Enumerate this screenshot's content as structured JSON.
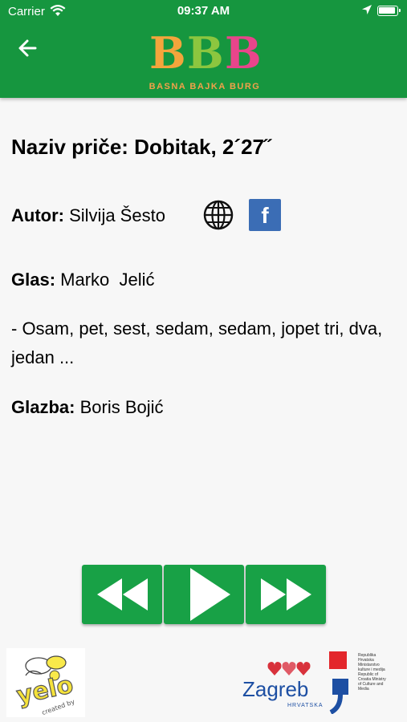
{
  "status": {
    "carrier": "Carrier",
    "time": "09:37 AM"
  },
  "header": {
    "logo_letters": [
      "B",
      "B",
      "B"
    ],
    "logo_subtitle": "BASNA BAJKA BURG",
    "colors": {
      "bar": "#16963f",
      "logo_orange": "#f4a53c",
      "logo_green": "#8cc63f",
      "logo_pink": "#e8458b"
    }
  },
  "story": {
    "title": "Naziv priče: Dobitak, 2´27˝",
    "author_label": "Autor:",
    "author_name": "Silvija Šesto",
    "voice_label": "Glas:",
    "voice_name": "Marko  Jelić",
    "quote": "- Osam, pet, sest, sedam, sedam, jopet tri, dva, jedan ...",
    "music_label": "Glazba:",
    "music_name": "Boris Bojić"
  },
  "icons": {
    "back": "arrow-left-icon",
    "web": "globe-icon",
    "facebook": "facebook-icon",
    "facebook_glyph": "f",
    "rewind": "rewind-icon",
    "play": "play-icon",
    "forward": "fast-forward-icon"
  },
  "controls_color": "#18a146",
  "footer": {
    "left_logo_text": "yelo",
    "left_logo_caption": "created by",
    "zagreb_text": "Zagreb",
    "zagreb_sub": "HRVATSKA",
    "ministry_text": "Republika Hrvatska Ministarstvo kulture i medija Republic of Croatia Ministry of Culture and Media"
  }
}
